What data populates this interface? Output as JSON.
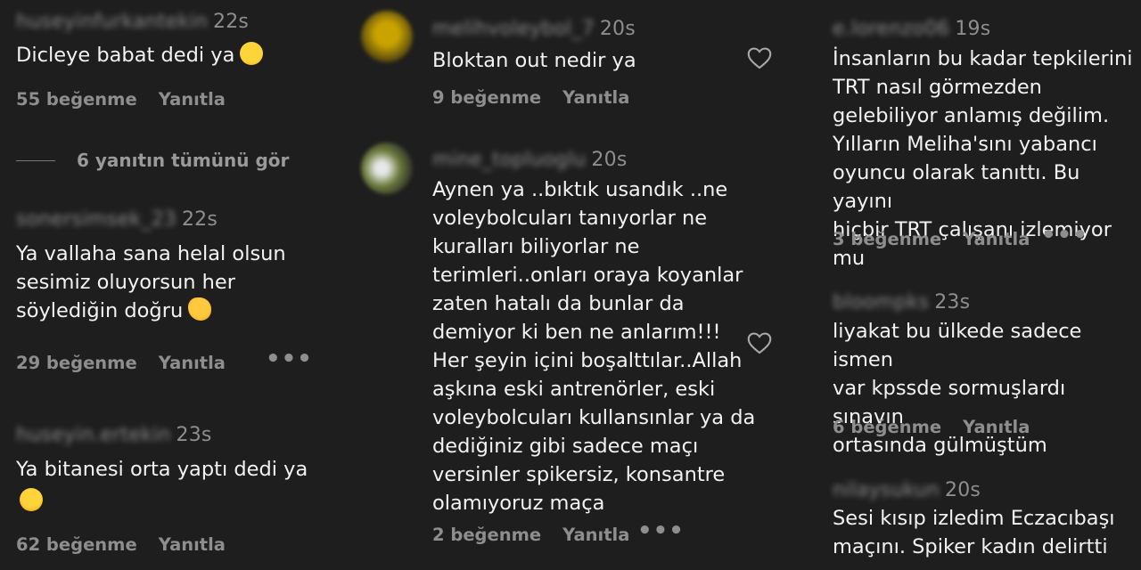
{
  "ui": {
    "like_suffix": "beğenme",
    "reply_label": "Yanıtla",
    "more_glyph": "•••"
  },
  "col1": {
    "c1": {
      "user": "huseyinfurkantekin",
      "time": "22s",
      "text": "Dicleye babat dedi ya",
      "emoji": "laughing-emoji",
      "likes": "55 beğenme",
      "reply": "Yanıtla"
    },
    "view_replies": "6 yanıtın tümünü gör",
    "c2": {
      "user": "sonersimsek_23",
      "time": "22s",
      "text": "Ya vallaha sana helal olsun\nsesimiz oluyorsun her\nsöylediğin doğru",
      "emoji": "clapping-emoji",
      "likes": "29 beğenme",
      "reply": "Yanıtla"
    },
    "c3": {
      "user": "huseyin.ertekin",
      "time": "23s",
      "text": "Ya bitanesi orta yaptı dedi ya",
      "emoji": "shocked-emoji",
      "likes": "62 beğenme",
      "reply": "Yanıtla"
    }
  },
  "col2": {
    "c1": {
      "user": "melihvoleybol_7",
      "time": "20s",
      "text": "Bloktan out nedir ya",
      "likes": "9 beğenme",
      "reply": "Yanıtla"
    },
    "c2": {
      "user": "mine_topluoglu",
      "time": "20s",
      "text": "Aynen ya ..bıktık usandık ..ne\nvoleybolcuları tanıyorlar ne\nkuralları biliyorlar ne\nterimleri..onları oraya koyanlar\nzaten hatalı da bunlar da\ndemiyor ki ben ne anlarım!!!\nHer şeyin içini boşalttılar..Allah\naşkına eski antrenörler, eski\nvoleybolcuları kullansınlar ya da\ndediğiniz gibi sadece maçı\nversinler spikersiz, konsantre\nolamıyoruz maça",
      "likes": "2 beğenme",
      "reply": "Yanıtla"
    }
  },
  "col3": {
    "c1": {
      "user": "e.lorenzo06",
      "time": "19s",
      "text": "İnsanların bu kadar tepkilerini\nTRT nasıl görmezden\ngelebiliyor anlamış değilim.\nYılların Meliha'sını yabancı\noyuncu olarak tanıttı. Bu yayını\nhiçbir TRT çalışanı izlemiyor mu",
      "likes": "3 beğenme",
      "reply": "Yanıtla"
    },
    "c2": {
      "user": "bloompks",
      "time": "23s",
      "text": "liyakat bu ülkede sadece ismen\nvar kpssde sormuşlardı sınavın\nortasında gülmüştüm",
      "likes": "6 beğenme",
      "reply": "Yanıtla"
    },
    "c3": {
      "user": "nilaysukun",
      "time": "20s",
      "text": "Sesi kısıp izledim Eczacıbaşı\nmaçını. Spiker kadın delirtti"
    }
  },
  "colors": {
    "background": "#1e1e1e",
    "text": "#f2f2f2",
    "muted": "#8e8e8e"
  }
}
